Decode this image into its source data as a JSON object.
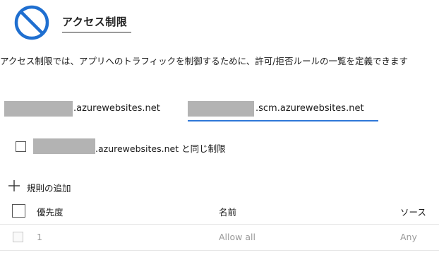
{
  "header": {
    "icon": "no-access-icon",
    "title": "アクセス制限"
  },
  "description": "アクセス制限では、アプリへのトラフィックを制御するために、許可/拒否ルールの一覧を定義できます",
  "tabs": [
    {
      "label": ".azurewebsites.net",
      "selected": false
    },
    {
      "label": ".scm.azurewebsites.net",
      "selected": true
    }
  ],
  "same_restriction": {
    "checked": false,
    "label": ".azurewebsites.net と同じ制限"
  },
  "add_rule": {
    "icon": "plus-icon",
    "label": "規則の追加"
  },
  "table": {
    "columns": [
      "優先度",
      "名前",
      "ソース"
    ],
    "rows": [
      {
        "priority": "1",
        "name": "Allow all",
        "source": "Any"
      }
    ]
  },
  "colors": {
    "accent": "#2f78d8",
    "icon": "#1f6fd0",
    "redaction": "#b3b3b3"
  }
}
